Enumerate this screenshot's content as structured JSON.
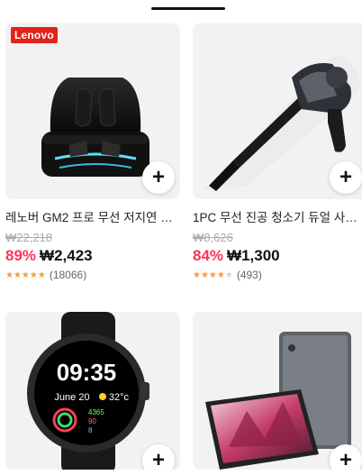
{
  "products": [
    {
      "badge": "Lenovo",
      "title": "레노버 GM2 프로 무선 저지연 이…",
      "original_price": "₩22,218",
      "discount": "89%",
      "price": "₩2,423",
      "rating_stars": "★★★★★",
      "rating": 4.8,
      "reviews": "(18066)",
      "add_label": "+",
      "image_icon": "earbuds-case-icon"
    },
    {
      "title": "1PC 무선 진공 청소기 듀얼 사용…",
      "original_price": "₩8,626",
      "discount": "84%",
      "price": "₩1,300",
      "rating_stars": "★★★★",
      "rating_stars_dim": "★",
      "rating": 4.0,
      "reviews": "(493)",
      "add_label": "+",
      "image_icon": "handheld-vacuum-icon"
    },
    {
      "add_label": "+",
      "image_icon": "smartwatch-icon",
      "watch_time": "09:35",
      "watch_date": "June 20",
      "watch_temp": "32°c",
      "watch_stats": [
        "4365",
        "90",
        "8"
      ]
    },
    {
      "add_label": "+",
      "image_icon": "tablet-icon"
    }
  ],
  "colors": {
    "discount": "#ff3355",
    "badge": "#e2231a",
    "stars": "#f59b45"
  }
}
